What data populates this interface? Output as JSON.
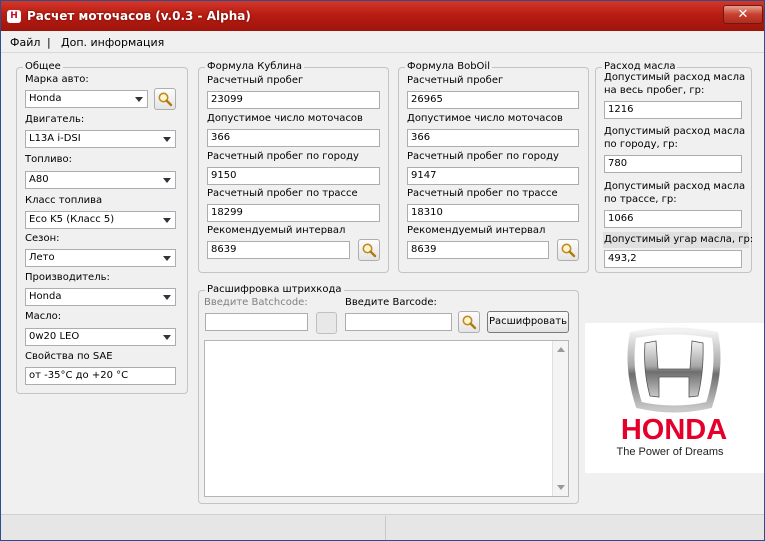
{
  "window": {
    "title": "Расчет моточасов (v.0.3 - Alpha)",
    "close_glyph": "✕"
  },
  "menu": {
    "file": "Файл",
    "separator": "|",
    "info": "Доп. информация"
  },
  "general": {
    "title": "Общее",
    "brand_label": "Марка авто:",
    "brand_value": "Honda",
    "engine_label": "Двигатель:",
    "engine_value": "L13A i-DSI",
    "fuel_label": "Топливо:",
    "fuel_value": "A80",
    "fuel_class_label": "Класс топлива",
    "fuel_class_value": "Eco K5 (Класс 5)",
    "season_label": "Сезон:",
    "season_value": "Лето",
    "maker_label": "Производитель:",
    "maker_value": "Honda",
    "oil_label": "Масло:",
    "oil_value": "0w20 LEO",
    "sae_label": "Свойства по SAE",
    "sae_value": "от -35°C до +20 °C"
  },
  "kublin": {
    "title": "Формула Кублина",
    "mileage_label": "Расчетный пробег",
    "mileage_value": "23099",
    "hours_label": "Допустимое число моточасов",
    "hours_value": "366",
    "city_label": "Расчетный пробег по городу",
    "city_value": "9150",
    "highway_label": "Расчетный  пробег по трассе",
    "highway_value": "18299",
    "interval_label": "Рекомендуемый интервал",
    "interval_value": "8639"
  },
  "boboil": {
    "title": "Формула BobOil",
    "mileage_label": "Расчетный пробег",
    "mileage_value": "26965",
    "hours_label": "Допустимое число моточасов",
    "hours_value": "366",
    "city_label": "Расчетный пробег по городу",
    "city_value": "9147",
    "highway_label": "Расчетный пробег по трассе",
    "highway_value": "18310",
    "interval_label": "Рекомендуемый интервал",
    "interval_value": "8639"
  },
  "oil": {
    "title": "Расход масла",
    "total_label_1": "Допустимый расход масла",
    "total_label_2": "на весь пробег, гр:",
    "total_value": "1216",
    "city_label_1": "Допустимый расход масла",
    "city_label_2": "по городу, гр:",
    "city_value": "780",
    "highway_label_1": "Допустимый расход масла",
    "highway_label_2": "по трассе, гр:",
    "highway_value": "1066",
    "burn_label": "Допустимый угар масла, гр:",
    "burn_value": "493,2"
  },
  "barcode": {
    "title": "Расшифровка штрихкода",
    "batch_label": "Введите Batchcode:",
    "batch_value": "",
    "barcode_label": "Введите Barcode:",
    "barcode_value": "",
    "decode_button": "Расшифровать",
    "output": ""
  },
  "logo": {
    "brand": "HONDA",
    "slogan": "The Power of Dreams",
    "red": "#e4002b"
  },
  "icons": {
    "search": "magnifier-icon",
    "app": "honda-app-icon",
    "close": "close-icon"
  }
}
